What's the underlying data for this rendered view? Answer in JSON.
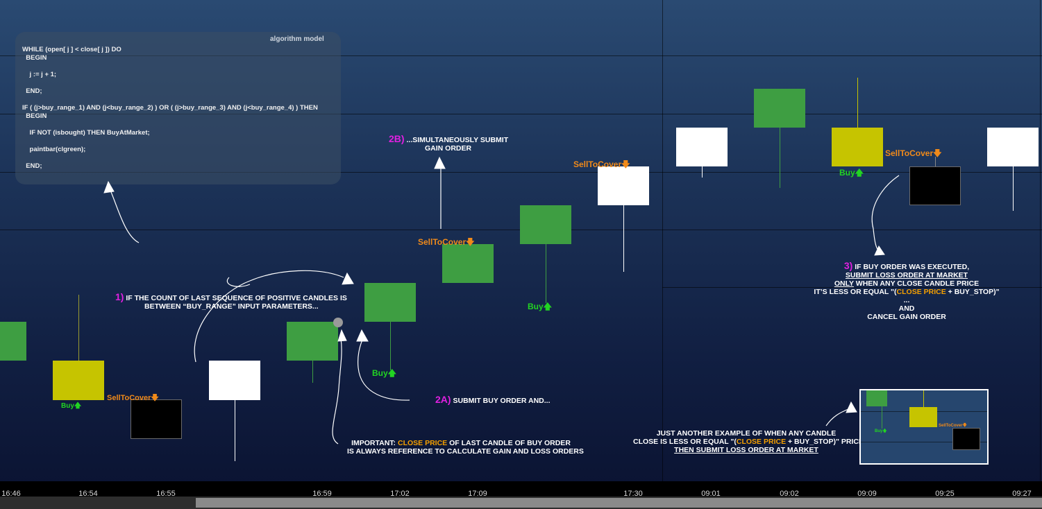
{
  "algorithm_panel": {
    "title": "algorithm model",
    "lines": [
      "WHILE (open[ j ] < close[ j ]) DO",
      "  BEGIN",
      "    j := j + 1;",
      "  END;",
      "IF ( (j>buy_range_1) AND (j<buy_range_2) ) OR ( (j>buy_range_3) AND (j<buy_range_4) ) THEN",
      "  BEGIN",
      "    IF NOT (isbought) THEN BuyAtMarket;",
      "    paintbar(clgreen);",
      "  END;"
    ]
  },
  "signals": {
    "buy": "Buy",
    "sell": "SellToCover"
  },
  "annotations": {
    "step1": {
      "num": "1)",
      "line1": "IF THE COUNT OF LAST SEQUENCE OF POSITIVE CANDLES IS",
      "line2": "BETWEEN “BUY_RANGE” INPUT PARAMETERS..."
    },
    "step2a": {
      "num": "2A)",
      "text": "SUBMIT BUY ORDER  AND..."
    },
    "step2b": {
      "num": "2B)",
      "line1": "...SIMULTANEOUSLY SUBMIT",
      "line2": "GAIN ORDER"
    },
    "step3": {
      "num": "3)",
      "line1": "IF BUY ORDER WAS EXECUTED,",
      "line2": "SUBMIT LOSS ORDER AT MARKET",
      "line3_u": "ONLY",
      "line3_rest": " WHEN ANY CLOSE CANDLE PRICE",
      "line4_a": "IT’S LESS OR EQUAL \"(",
      "line4_b": "CLOSE PRICE",
      "line4_c": " + BUY_STOP)\"",
      "line5": "...",
      "line6": "AND",
      "line7": "CANCEL GAIN ORDER"
    },
    "important": {
      "label": "IMPORTANT: ",
      "highlight": "CLOSE PRICE",
      "rest": " OF LAST CANDLE OF BUY ORDER",
      "line2": "IS ALWAYS REFERENCE TO CALCULATE GAIN AND LOSS ORDERS"
    },
    "example": {
      "line1": "JUST ANOTHER EXAMPLE OF WHEN ANY CANDLE",
      "line2_a": "CLOSE IS LESS OR EQUAL \"(",
      "line2_b": "CLOSE PRICE",
      "line2_c": " + BUY_STOP)\" PRICE",
      "line3": "THEN SUBMIT LOSS ORDER AT MARKET"
    }
  },
  "time_axis": [
    "16:46",
    "16:54",
    "16:55",
    "16:59",
    "17:02",
    "17:09",
    "17:30",
    "09:01",
    "09:02",
    "09:09",
    "09:25",
    "09:27"
  ],
  "colors": {
    "bullish": "#3e9e42",
    "highlight_bar": "#c6c400",
    "bearish": "#ffffff",
    "loss_bar": "#000000",
    "buy_signal": "#22d422",
    "sell_signal": "#f08a1a",
    "step_number": "#e020e0",
    "close_price_highlight": "#f5a000"
  }
}
